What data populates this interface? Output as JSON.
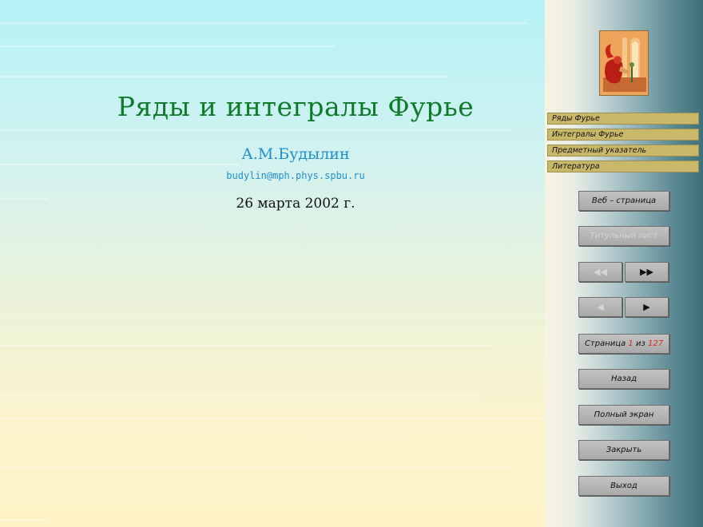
{
  "presentation": {
    "title": "Ряды и интегралы Фурье",
    "author": "А.М.Будылин",
    "email": "budylin@mph.phys.spbu.ru",
    "date": "26 марта 2002 г."
  },
  "sidebar": {
    "nav_items": [
      {
        "label": "Ряды Фурье"
      },
      {
        "label": "Интегралы Фурье"
      },
      {
        "label": "Предметный указатель"
      },
      {
        "label": "Литература"
      }
    ],
    "buttons": {
      "web_page": "Веб – страница",
      "title_page": "Титульный лист",
      "prev_section": "◀◀",
      "next_section": "▶▶",
      "prev_page": "◀",
      "next_page": "▶",
      "page_prefix": "Страница",
      "page_current": "1",
      "page_of": "из",
      "page_total": "127",
      "back": "Назад",
      "fullscreen": "Полный экран",
      "close": "Закрыть",
      "exit": "Выход"
    }
  },
  "colors": {
    "title": "#0e7a2a",
    "author": "#1e8fd0",
    "nav_bg": "#c9b86a",
    "button_bg": "#b5b5b5",
    "page_number": "#e0261c"
  }
}
